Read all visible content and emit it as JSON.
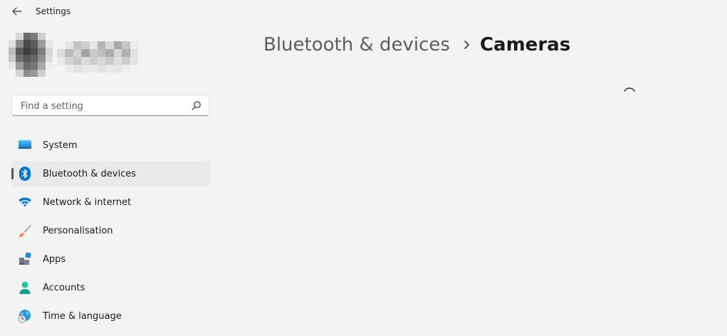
{
  "window": {
    "title": "Settings"
  },
  "search": {
    "placeholder": "Find a setting"
  },
  "sidebar": {
    "items": [
      {
        "label": "System",
        "icon": "monitor-icon"
      },
      {
        "label": "Bluetooth & devices",
        "icon": "bluetooth-icon",
        "selected": true
      },
      {
        "label": "Network & internet",
        "icon": "wifi-icon"
      },
      {
        "label": "Personalisation",
        "icon": "paintbrush-icon"
      },
      {
        "label": "Apps",
        "icon": "apps-icon"
      },
      {
        "label": "Accounts",
        "icon": "person-icon"
      },
      {
        "label": "Time & language",
        "icon": "globe-clock-icon"
      }
    ]
  },
  "breadcrumb": {
    "parent": "Bluetooth & devices",
    "current": "Cameras"
  },
  "colors": {
    "background": "#f3f3f3",
    "accent": "#0067c0",
    "selected_item": "#eaeaea"
  }
}
